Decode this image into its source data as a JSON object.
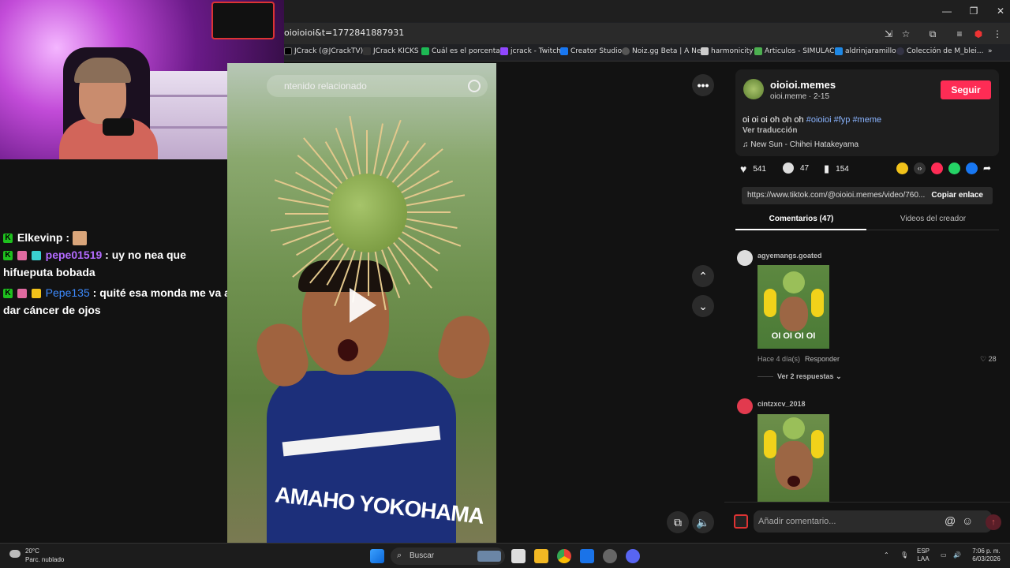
{
  "browser": {
    "url": "oioioioi&t=1772841887931",
    "bookmarks": [
      "JCrack (@JCrackTV)...",
      "JCrack KICKS",
      "Cuál es el porcentaj...",
      "jcrack - Twitch",
      "Creator Studio",
      "Noiz.gg Beta | A Ne...",
      "harmonicity",
      "Articulos - SIMULAC...",
      "aldrinjaramillo",
      "Colección de M_blei..."
    ],
    "bookmark_colors": [
      "#000000",
      "#111111",
      "#1db954",
      "#9147ff",
      "#1877f2",
      "#444444",
      "#cccccc",
      "#4caf50",
      "#1e88e5",
      "#222233"
    ]
  },
  "chat": {
    "messages": [
      {
        "user": "Elkevinp",
        "user_color": "#ffffff",
        "text": ""
      },
      {
        "user": "pepe01519",
        "user_color": "#b36bff",
        "text": "uy no nea que hifueputa bobada"
      },
      {
        "user": "Pepe135",
        "user_color": "#3d8bff",
        "text": "quité esa monda me va a dar cáncer de ojos"
      }
    ]
  },
  "video": {
    "search_placeholder": "ntenido relacionado",
    "shirt_text": "AMAHO YOKOHAMA"
  },
  "post": {
    "username": "oioioi.memes",
    "handle_date": "oioi.meme · 2-15",
    "follow_label": "Seguir",
    "caption_text": "oi oi oi oh oh oh",
    "hashtags": "#oioioi #fyp #meme",
    "translate_label": "Ver traducción",
    "music": "New Sun - Chihei Hatakeyama",
    "likes": "541",
    "comments": "47",
    "saves": "154",
    "link": "https://www.tiktok.com/@oioioi.memes/video/760...",
    "copy_label": "Copiar enlace",
    "tab_comments": "Comentarios (47)",
    "tab_creator": "Videos del creador"
  },
  "comments": [
    {
      "user": "agyemangs.goated",
      "image_caption": "OI OI OI OI",
      "time": "Hace 4 día(s)",
      "reply": "Responder",
      "likes": "28",
      "more": "Ver 2 respuestas"
    },
    {
      "user": "cintzxcv_2018"
    }
  ],
  "comment_box": {
    "placeholder": "Añadir comentario..."
  },
  "taskbar": {
    "temp": "20°C",
    "weather": "Parc. nublado",
    "search": "Buscar",
    "lang1": "ESP",
    "lang2": "LAA",
    "time": "7:06 p. m.",
    "date": "6/03/2026"
  },
  "colors": {
    "follow": "#fe2c55",
    "hashtag": "#8ab4ff"
  }
}
